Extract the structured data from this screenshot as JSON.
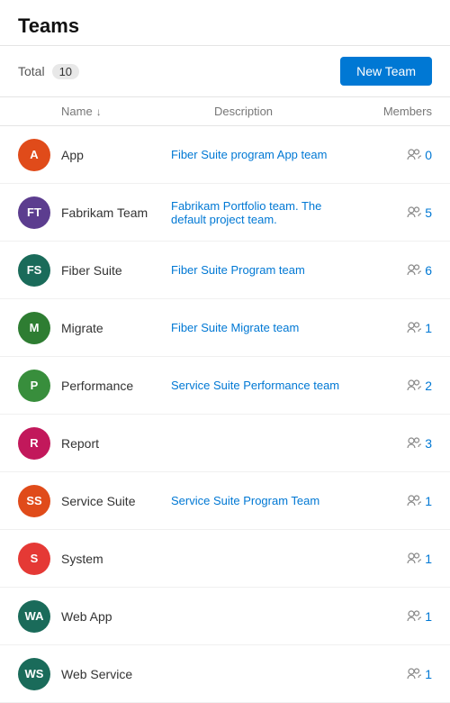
{
  "page": {
    "title": "Teams"
  },
  "toolbar": {
    "total_label": "Total",
    "total_count": "10",
    "new_team_label": "New Team"
  },
  "table": {
    "col_name": "Name",
    "col_sort_arrow": "↓",
    "col_desc": "Description",
    "col_members": "Members"
  },
  "teams": [
    {
      "initials": "A",
      "name": "App",
      "description": "Fiber Suite program App team",
      "members": "0",
      "color": "#e04b1a"
    },
    {
      "initials": "FT",
      "name": "Fabrikam Team",
      "description": "Fabrikam Portfolio team. The default project team.",
      "members": "5",
      "color": "#5c3d8f"
    },
    {
      "initials": "FS",
      "name": "Fiber Suite",
      "description": "Fiber Suite Program team",
      "members": "6",
      "color": "#1a6b5a"
    },
    {
      "initials": "M",
      "name": "Migrate",
      "description": "Fiber Suite Migrate team",
      "members": "1",
      "color": "#2e7d32"
    },
    {
      "initials": "P",
      "name": "Performance",
      "description": "Service Suite Performance team",
      "members": "2",
      "color": "#388e3c"
    },
    {
      "initials": "R",
      "name": "Report",
      "description": "",
      "members": "3",
      "color": "#c2185b"
    },
    {
      "initials": "SS",
      "name": "Service Suite",
      "description": "Service Suite Program Team",
      "members": "1",
      "color": "#e04b1a"
    },
    {
      "initials": "S",
      "name": "System",
      "description": "",
      "members": "1",
      "color": "#e53935"
    },
    {
      "initials": "WA",
      "name": "Web App",
      "description": "",
      "members": "1",
      "color": "#1a6b5a"
    },
    {
      "initials": "WS",
      "name": "Web Service",
      "description": "",
      "members": "1",
      "color": "#1a6b5a"
    }
  ]
}
